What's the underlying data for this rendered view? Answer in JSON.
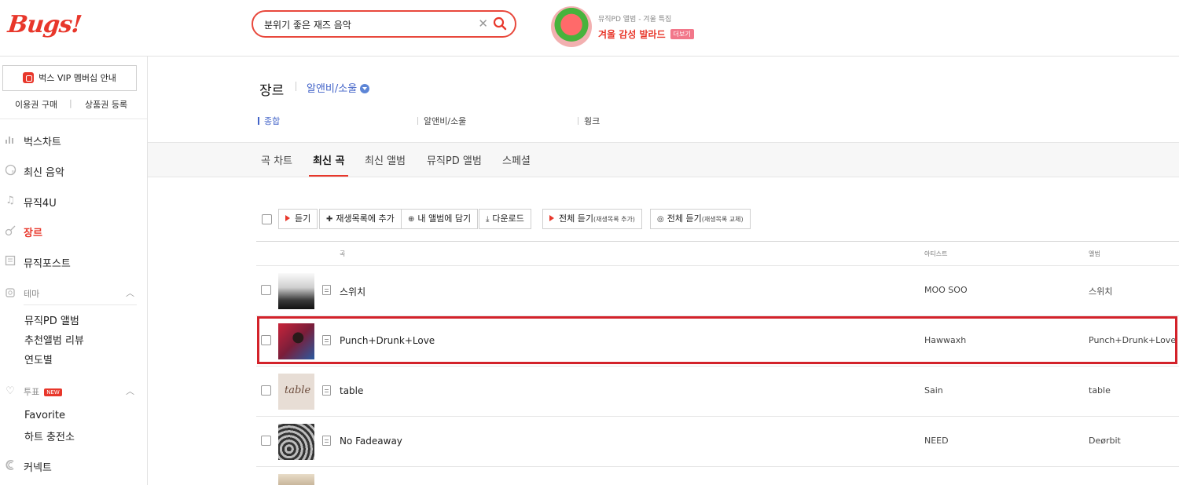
{
  "header": {
    "logo": "Bugs!",
    "search": {
      "value": "분위기 좋은 재즈 음악",
      "clear_icon": "✕"
    },
    "promo": {
      "subtitle": "뮤직PD 앨범 - 겨울 특집",
      "title": "겨울 감성 발라드",
      "more": "더보기"
    }
  },
  "sidebar": {
    "vip_label": "벅스 VIP 멤버십 안내",
    "links": [
      "이용권 구매",
      "상품권 등록"
    ],
    "nav": [
      {
        "label": "벅스차트",
        "icon": "chart-icon"
      },
      {
        "label": "최신 음악",
        "icon": "new-music-icon"
      },
      {
        "label": "뮤직4U",
        "icon": "music-note-icon"
      },
      {
        "label": "장르",
        "icon": "guitar-icon",
        "active": true
      },
      {
        "label": "뮤직포스트",
        "icon": "post-icon"
      }
    ],
    "theme": {
      "label": "테마",
      "items": [
        "뮤직PD 앨범",
        "추천앨범 리뷰",
        "연도별"
      ]
    },
    "vote": {
      "label": "투표",
      "badge": "NEW",
      "items": [
        "Favorite",
        "하트 충전소"
      ]
    },
    "connect": {
      "label": "커넥트"
    }
  },
  "main": {
    "genre_title": "장르",
    "genre_selected": "알앤비/소울",
    "subgenres": [
      "종합",
      "알앤비/소울",
      "훵크"
    ],
    "tabs": [
      "곡 차트",
      "최신 곡",
      "최신 앨범",
      "뮤직PD 앨범",
      "스페셜"
    ],
    "active_tab": "최신 곡",
    "toolbar": {
      "listen": "듣기",
      "add_playlist": "재생목록에 추가",
      "add_album": "내 앨범에 담기",
      "download": "다운로드",
      "play_all_add": "전체 듣기",
      "play_all_add_note": "(재생목록 추가)",
      "play_all_replace": "전체 듣기",
      "play_all_replace_note": "(재생목록 교체)"
    },
    "columns": {
      "song": "곡",
      "artist": "아티스트",
      "album": "앨범"
    },
    "songs": [
      {
        "title": "스위치",
        "artist": "MOO SOO",
        "album": "스위치"
      },
      {
        "title": "Punch+Drunk+Love",
        "artist": "Hawwaxh",
        "album": "Punch+Drunk+Love"
      },
      {
        "title": "table",
        "artist": "Sain",
        "album": "table"
      },
      {
        "title": "No Fadeaway",
        "artist": "NEED",
        "album": "Deørbit"
      }
    ],
    "thumb_text": "table"
  },
  "colors": {
    "accent": "#e8372b",
    "link": "#4263c8",
    "highlight": "#d3222a"
  }
}
